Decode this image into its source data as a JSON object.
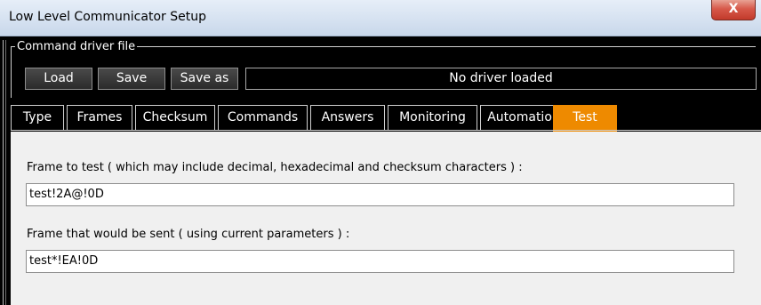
{
  "window": {
    "title": "Low Level Communicator Setup",
    "close_label": "X"
  },
  "driver_group": {
    "label": "Command driver file",
    "load_label": "Load",
    "save_label": "Save",
    "save_as_label": "Save as",
    "status": "No driver loaded"
  },
  "tabs": [
    {
      "label": "Type"
    },
    {
      "label": "Frames"
    },
    {
      "label": "Checksum"
    },
    {
      "label": "Commands"
    },
    {
      "label": "Answers"
    },
    {
      "label": "Monitoring"
    },
    {
      "label": "Automation"
    },
    {
      "label": "Test",
      "active": true
    }
  ],
  "test_panel": {
    "frame_to_test_label": "Frame to test ( which may include decimal, hexadecimal and checksum characters ) :",
    "frame_to_test_value": "test!2A@!0D",
    "frame_sent_label": "Frame that would be sent ( using current parameters ) :",
    "frame_sent_value": "test*!EA!0D"
  },
  "colors": {
    "active_tab": "#ee8a00",
    "panel_bg": "#f0f0f0",
    "close_button": "#c7463a"
  }
}
